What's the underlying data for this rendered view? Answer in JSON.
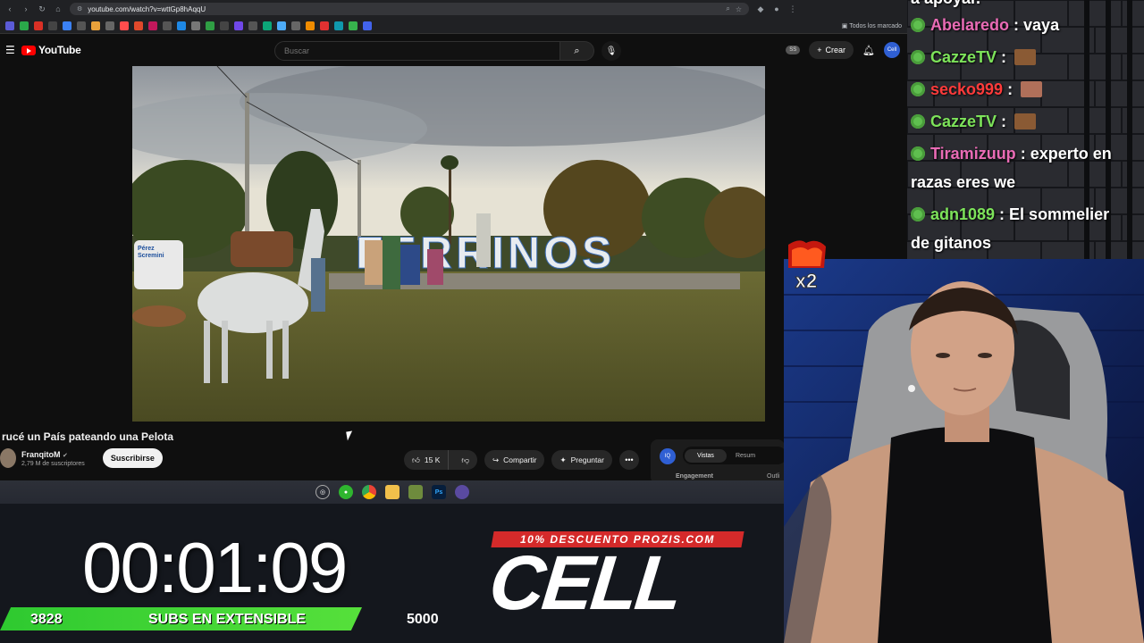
{
  "browser": {
    "url": "youtube.com/watch?v=wttGp8hAqqU",
    "bookmarks_folder": "Todos los marcado"
  },
  "youtube": {
    "logo_text": "YouTube",
    "search_placeholder": "Buscar",
    "ss_badge": "SS",
    "create_label": "Crear",
    "avatar_text": "Cell",
    "video": {
      "title": "rucé un País pateando una Pelota",
      "channel_name": "FranqitoM",
      "channel_subs": "2,79 M de suscriptores",
      "subscribe_label": "Suscribirse",
      "likes": "15 K",
      "share_label": "Compartir",
      "ask_label": "Preguntar",
      "scene_sign": "FERRINOS"
    },
    "side_panel": {
      "tab_active": "Vistas",
      "tab_other": "Resum",
      "engagement_label": "Engagement",
      "outline_label": "Outli"
    }
  },
  "taskbar": {
    "icons": [
      "cursor-icon",
      "xbox-icon",
      "chrome-icon",
      "folder-icon",
      "minecraft-icon",
      "photoshop-icon",
      "obs-icon"
    ],
    "ps_label": "Ps"
  },
  "chat": {
    "lines": [
      {
        "user": "Abelaredo",
        "message": "vaya",
        "color": "#e96bb5"
      },
      {
        "user": "CazzeTV",
        "message": "",
        "color": "#7de35a"
      },
      {
        "user": "secko999",
        "message": "",
        "color": "#ff3b3b"
      },
      {
        "user": "CazzeTV",
        "message": "",
        "color": "#7de35a"
      },
      {
        "user": "Tiramizuup",
        "message": "experto en",
        "message_cont": "razas eres we",
        "color": "#e96bb5"
      },
      {
        "user": "adn1089",
        "message": "El sommelier",
        "message_cont": "de gitanos",
        "color": "#7de35a"
      }
    ],
    "partial_top": "a apoyar."
  },
  "overlay": {
    "multiplier": "x2",
    "timer": "00:01:09",
    "subs_current": "3828",
    "subs_label": "SUBS EN EXTENSIBLE",
    "subs_goal": "5000",
    "promo": "10% DESCUENTO PROZIS.COM",
    "brand": "CELL",
    "accent_green": "#3fd43a",
    "accent_red": "#d42a2a"
  }
}
